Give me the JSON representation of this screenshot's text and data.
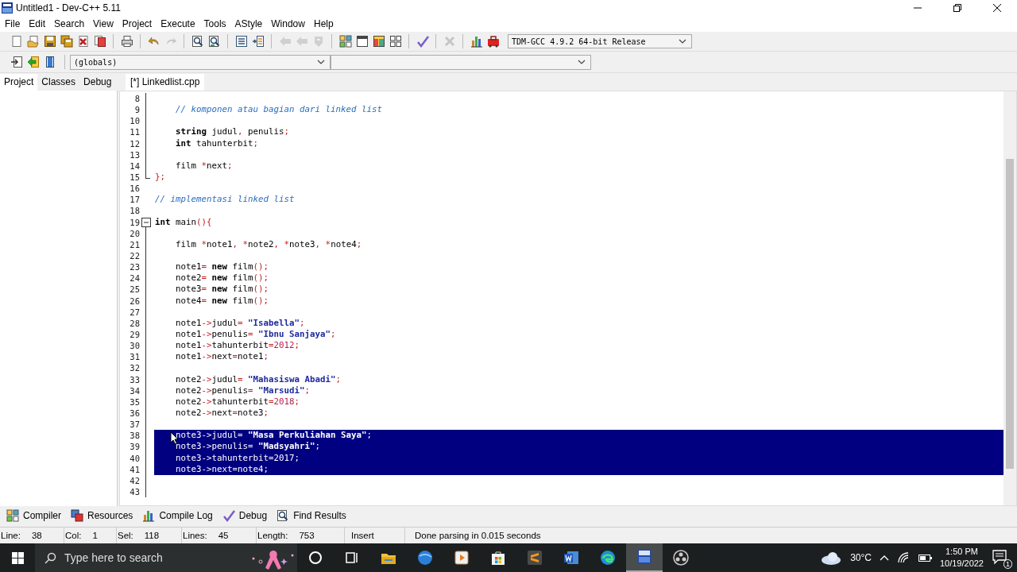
{
  "window": {
    "title": "Untitled1 - Dev-C++ 5.11"
  },
  "menu": [
    "File",
    "Edit",
    "Search",
    "View",
    "Project",
    "Execute",
    "Tools",
    "AStyle",
    "Window",
    "Help"
  ],
  "toolbar": [
    {
      "kind": "new",
      "disabled": false
    },
    {
      "kind": "open",
      "disabled": false
    },
    {
      "kind": "save",
      "disabled": false
    },
    {
      "kind": "saveall",
      "disabled": false
    },
    {
      "kind": "close",
      "disabled": false
    },
    {
      "kind": "closeall",
      "disabled": false
    },
    {
      "kind": "sep"
    },
    {
      "kind": "print",
      "disabled": false
    },
    {
      "kind": "sep"
    },
    {
      "kind": "undo",
      "disabled": false
    },
    {
      "kind": "redo",
      "disabled": true
    },
    {
      "kind": "sep"
    },
    {
      "kind": "find",
      "disabled": false
    },
    {
      "kind": "replace",
      "disabled": false
    },
    {
      "kind": "sep"
    },
    {
      "kind": "indent",
      "disabled": false
    },
    {
      "kind": "unindent",
      "disabled": false
    },
    {
      "kind": "sep"
    },
    {
      "kind": "back",
      "disabled": true
    },
    {
      "kind": "forward",
      "disabled": true
    },
    {
      "kind": "bookmark",
      "disabled": true
    },
    {
      "kind": "sep"
    },
    {
      "kind": "tiles",
      "disabled": false
    },
    {
      "kind": "window",
      "disabled": false
    },
    {
      "kind": "panes",
      "disabled": false
    },
    {
      "kind": "grid",
      "disabled": false
    },
    {
      "kind": "sep"
    },
    {
      "kind": "check",
      "disabled": false
    },
    {
      "kind": "sep"
    },
    {
      "kind": "delete",
      "disabled": true
    },
    {
      "kind": "sep"
    },
    {
      "kind": "chart",
      "disabled": false
    },
    {
      "kind": "profile",
      "disabled": false
    }
  ],
  "compiler": {
    "value": "TDM-GCC 4.9.2 64-bit Release"
  },
  "toolbar2": [
    {
      "kind": "page-arrow"
    },
    {
      "kind": "green-arrow"
    },
    {
      "kind": "blue-page"
    }
  ],
  "scope": {
    "value": "(globals)"
  },
  "side_tabs": [
    {
      "label": "Project",
      "selected": true
    },
    {
      "label": "Classes",
      "selected": false
    },
    {
      "label": "Debug",
      "selected": false
    }
  ],
  "editor_tabs": [
    {
      "label": "[*] Linkedlist.cpp",
      "selected": true
    }
  ],
  "code": [
    {
      "number": "8",
      "kind": "inside",
      "selected": false
    },
    {
      "number": "9",
      "kind": "inside",
      "selected": false,
      "indented": true,
      "segments": [
        {
          "kind": "comment",
          "text": "// komponen atau bagian dari linked list"
        }
      ]
    },
    {
      "number": "10",
      "kind": "inside",
      "selected": false
    },
    {
      "number": "11",
      "kind": "inside",
      "selected": false,
      "indented": true,
      "segments": [
        {
          "kind": "kw",
          "text": "string"
        },
        {
          "kind": "text",
          "text": " judul"
        },
        {
          "kind": "sym",
          "text": ","
        },
        {
          "kind": "text",
          "text": " penulis"
        },
        {
          "kind": "sym",
          "text": ";"
        }
      ]
    },
    {
      "number": "12",
      "kind": "inside",
      "selected": false,
      "indented": true,
      "segments": [
        {
          "kind": "kw",
          "text": "int"
        },
        {
          "kind": "text",
          "text": " tahunterbit"
        },
        {
          "kind": "sym",
          "text": ";"
        }
      ]
    },
    {
      "number": "13",
      "kind": "inside",
      "selected": false
    },
    {
      "number": "14",
      "kind": "inside",
      "selected": false,
      "indented": true,
      "segments": [
        {
          "kind": "text",
          "text": "film "
        },
        {
          "kind": "sym",
          "text": "*"
        },
        {
          "kind": "text",
          "text": "next"
        },
        {
          "kind": "sym",
          "text": ";"
        }
      ]
    },
    {
      "number": "15",
      "kind": "close",
      "selected": false,
      "indented": false,
      "segments": [
        {
          "kind": "sym",
          "text": "};"
        }
      ]
    },
    {
      "number": "16",
      "kind": "plain",
      "selected": false
    },
    {
      "number": "17",
      "kind": "plain",
      "selected": false,
      "indented": false,
      "segments": [
        {
          "kind": "comment",
          "text": "// implementasi linked list"
        }
      ]
    },
    {
      "number": "18",
      "kind": "plain",
      "selected": false
    },
    {
      "number": "19",
      "kind": "open",
      "selected": false,
      "indented": false,
      "segments": [
        {
          "kind": "kw",
          "text": "int"
        },
        {
          "kind": "text",
          "text": " main"
        },
        {
          "kind": "sym",
          "text": "(){"
        }
      ]
    },
    {
      "number": "20",
      "kind": "inside",
      "selected": false
    },
    {
      "number": "21",
      "kind": "inside",
      "selected": false,
      "indented": true,
      "segments": [
        {
          "kind": "text",
          "text": "film "
        },
        {
          "kind": "sym",
          "text": "*"
        },
        {
          "kind": "text",
          "text": "note1"
        },
        {
          "kind": "sym",
          "text": ", *"
        },
        {
          "kind": "text",
          "text": "note2"
        },
        {
          "kind": "sym",
          "text": ", *"
        },
        {
          "kind": "text",
          "text": "note3"
        },
        {
          "kind": "sym",
          "text": ", *"
        },
        {
          "kind": "text",
          "text": "note4"
        },
        {
          "kind": "sym",
          "text": ";"
        }
      ]
    },
    {
      "number": "22",
      "kind": "inside",
      "selected": false
    },
    {
      "number": "23",
      "kind": "inside",
      "selected": false,
      "indented": true,
      "segments": [
        {
          "kind": "text",
          "text": "note1"
        },
        {
          "kind": "sym",
          "text": "="
        },
        {
          "kind": "kw",
          "text": " new"
        },
        {
          "kind": "text",
          "text": " film"
        },
        {
          "kind": "sym",
          "text": "();"
        }
      ]
    },
    {
      "number": "24",
      "kind": "inside",
      "selected": false,
      "indented": true,
      "segments": [
        {
          "kind": "text",
          "text": "note2"
        },
        {
          "kind": "sym",
          "text": "="
        },
        {
          "kind": "kw",
          "text": " new"
        },
        {
          "kind": "text",
          "text": " film"
        },
        {
          "kind": "sym",
          "text": "();"
        }
      ]
    },
    {
      "number": "25",
      "kind": "inside",
      "selected": false,
      "indented": true,
      "segments": [
        {
          "kind": "text",
          "text": "note3"
        },
        {
          "kind": "sym",
          "text": "="
        },
        {
          "kind": "kw",
          "text": " new"
        },
        {
          "kind": "text",
          "text": " film"
        },
        {
          "kind": "sym",
          "text": "();"
        }
      ]
    },
    {
      "number": "26",
      "kind": "inside",
      "selected": false,
      "indented": true,
      "segments": [
        {
          "kind": "text",
          "text": "note4"
        },
        {
          "kind": "sym",
          "text": "="
        },
        {
          "kind": "kw",
          "text": " new"
        },
        {
          "kind": "text",
          "text": " film"
        },
        {
          "kind": "sym",
          "text": "();"
        }
      ]
    },
    {
      "number": "27",
      "kind": "inside",
      "selected": false
    },
    {
      "number": "28",
      "kind": "inside",
      "selected": false,
      "indented": true,
      "segments": [
        {
          "kind": "text",
          "text": "note1"
        },
        {
          "kind": "sym",
          "text": "->"
        },
        {
          "kind": "text",
          "text": "judul"
        },
        {
          "kind": "sym",
          "text": "="
        },
        {
          "kind": "str",
          "text": " \"Isabella\""
        },
        {
          "kind": "sym",
          "text": ";"
        }
      ]
    },
    {
      "number": "29",
      "kind": "inside",
      "selected": false,
      "indented": true,
      "segments": [
        {
          "kind": "text",
          "text": "note1"
        },
        {
          "kind": "sym",
          "text": "->"
        },
        {
          "kind": "text",
          "text": "penulis"
        },
        {
          "kind": "sym",
          "text": "="
        },
        {
          "kind": "str",
          "text": " \"Ibnu Sanjaya\""
        },
        {
          "kind": "sym",
          "text": ";"
        }
      ]
    },
    {
      "number": "30",
      "kind": "inside",
      "selected": false,
      "indented": true,
      "segments": [
        {
          "kind": "text",
          "text": "note1"
        },
        {
          "kind": "sym",
          "text": "->"
        },
        {
          "kind": "text",
          "text": "tahunterbit"
        },
        {
          "kind": "sym",
          "text": "="
        },
        {
          "kind": "num",
          "text": "2012"
        },
        {
          "kind": "sym",
          "text": ";"
        }
      ]
    },
    {
      "number": "31",
      "kind": "inside",
      "selected": false,
      "indented": true,
      "segments": [
        {
          "kind": "text",
          "text": "note1"
        },
        {
          "kind": "sym",
          "text": "->"
        },
        {
          "kind": "text",
          "text": "next"
        },
        {
          "kind": "sym",
          "text": "="
        },
        {
          "kind": "text",
          "text": "note1"
        },
        {
          "kind": "sym",
          "text": ";"
        }
      ]
    },
    {
      "number": "32",
      "kind": "inside",
      "selected": false
    },
    {
      "number": "33",
      "kind": "inside",
      "selected": false,
      "indented": true,
      "segments": [
        {
          "kind": "text",
          "text": "note2"
        },
        {
          "kind": "sym",
          "text": "->"
        },
        {
          "kind": "text",
          "text": "judul"
        },
        {
          "kind": "sym",
          "text": "="
        },
        {
          "kind": "str",
          "text": " \"Mahasiswa Abadi\""
        },
        {
          "kind": "sym",
          "text": ";"
        }
      ]
    },
    {
      "number": "34",
      "kind": "inside",
      "selected": false,
      "indented": true,
      "segments": [
        {
          "kind": "text",
          "text": "note2"
        },
        {
          "kind": "sym",
          "text": "->"
        },
        {
          "kind": "text",
          "text": "penulis"
        },
        {
          "kind": "sym",
          "text": "="
        },
        {
          "kind": "str",
          "text": " \"Marsudi\""
        },
        {
          "kind": "sym",
          "text": ";"
        }
      ]
    },
    {
      "number": "35",
      "kind": "inside",
      "selected": false,
      "indented": true,
      "segments": [
        {
          "kind": "text",
          "text": "note2"
        },
        {
          "kind": "sym",
          "text": "->"
        },
        {
          "kind": "text",
          "text": "tahunterbit"
        },
        {
          "kind": "sym",
          "text": "="
        },
        {
          "kind": "num",
          "text": "2018"
        },
        {
          "kind": "sym",
          "text": ";"
        }
      ]
    },
    {
      "number": "36",
      "kind": "inside",
      "selected": false,
      "indented": true,
      "segments": [
        {
          "kind": "text",
          "text": "note2"
        },
        {
          "kind": "sym",
          "text": "->"
        },
        {
          "kind": "text",
          "text": "next"
        },
        {
          "kind": "sym",
          "text": "="
        },
        {
          "kind": "text",
          "text": "note3"
        },
        {
          "kind": "sym",
          "text": ";"
        }
      ]
    },
    {
      "number": "37",
      "kind": "inside",
      "selected": false
    },
    {
      "number": "38",
      "kind": "inside",
      "selected": true,
      "indented": true,
      "segments": [
        {
          "kind": "text",
          "text": "note3"
        },
        {
          "kind": "sym",
          "text": "->"
        },
        {
          "kind": "text",
          "text": "judul"
        },
        {
          "kind": "sym",
          "text": "="
        },
        {
          "kind": "str",
          "text": " \"Masa Perkuliahan Saya\""
        },
        {
          "kind": "sym",
          "text": ";"
        }
      ]
    },
    {
      "number": "39",
      "kind": "inside",
      "selected": true,
      "indented": true,
      "segments": [
        {
          "kind": "text",
          "text": "note3"
        },
        {
          "kind": "sym",
          "text": "->"
        },
        {
          "kind": "text",
          "text": "penulis"
        },
        {
          "kind": "sym",
          "text": "="
        },
        {
          "kind": "str",
          "text": " \"Madsyahri\""
        },
        {
          "kind": "sym",
          "text": ";"
        }
      ]
    },
    {
      "number": "40",
      "kind": "inside",
      "selected": true,
      "indented": true,
      "segments": [
        {
          "kind": "text",
          "text": "note3"
        },
        {
          "kind": "sym",
          "text": "->"
        },
        {
          "kind": "text",
          "text": "tahunterbit"
        },
        {
          "kind": "sym",
          "text": "="
        },
        {
          "kind": "num",
          "text": "2017"
        },
        {
          "kind": "sym",
          "text": ";"
        }
      ]
    },
    {
      "number": "41",
      "kind": "inside",
      "selected": true,
      "indented": true,
      "segments": [
        {
          "kind": "text",
          "text": "note3"
        },
        {
          "kind": "sym",
          "text": "->"
        },
        {
          "kind": "text",
          "text": "next"
        },
        {
          "kind": "sym",
          "text": "="
        },
        {
          "kind": "text",
          "text": "note4"
        },
        {
          "kind": "sym",
          "text": ";"
        }
      ]
    },
    {
      "number": "42",
      "kind": "inside",
      "selected": false
    },
    {
      "number": "43",
      "kind": "inside",
      "selected": false
    }
  ],
  "bottom_tabs": [
    {
      "kind": "compiler",
      "label": "Compiler"
    },
    {
      "kind": "resources",
      "label": "Resources"
    },
    {
      "kind": "log",
      "label": "Compile Log"
    },
    {
      "kind": "debug",
      "label": "Debug"
    },
    {
      "kind": "find",
      "label": "Find Results"
    }
  ],
  "status_bar": [
    {
      "label": "Line:",
      "value": "38"
    },
    {
      "label": "Col:",
      "value": "1"
    },
    {
      "label": "Sel:",
      "value": "118"
    },
    {
      "label": "Lines:",
      "value": "45"
    },
    {
      "label": "Length:",
      "value": "753"
    },
    {
      "label": "Insert"
    },
    {
      "label": "Done parsing in 0.015 seconds"
    }
  ],
  "taskbar": {
    "search": {
      "placeholder": "Type here to search"
    },
    "apps": [
      {
        "kind": "cortana",
        "active": false
      },
      {
        "kind": "taskview",
        "active": false
      },
      {
        "kind": "explorer",
        "active": false
      },
      {
        "kind": "globe",
        "active": false
      },
      {
        "kind": "media",
        "active": false
      },
      {
        "kind": "store",
        "active": false
      },
      {
        "kind": "sublime",
        "active": false
      },
      {
        "kind": "word",
        "active": false
      },
      {
        "kind": "edge",
        "active": false
      },
      {
        "kind": "devcpp",
        "active": true
      },
      {
        "kind": "obs",
        "active": false
      }
    ],
    "weather": "30°C",
    "time": "1:50 PM",
    "date": "10/19/2022",
    "notifications": "1"
  }
}
